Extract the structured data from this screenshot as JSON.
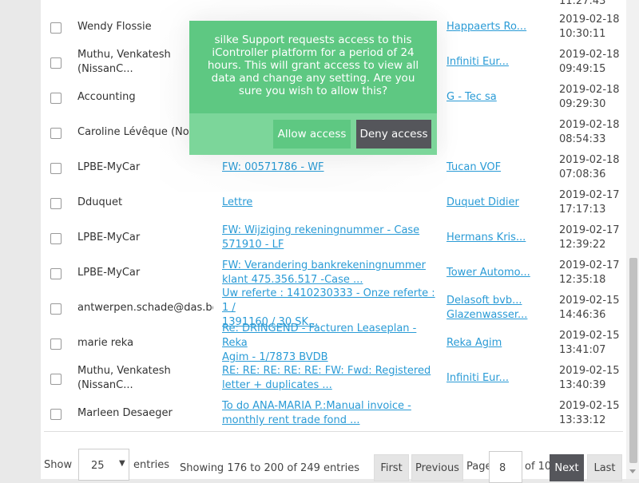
{
  "table": {
    "top_partial_time": "11:27:43",
    "rows": [
      {
        "name": "Wendy Flossie",
        "subject": "",
        "contact": "Happaerts Ro...",
        "date": "2019-02-18\n10:30:11"
      },
      {
        "name": "Muthu, Venkatesh\n(NissanC...",
        "subject": "",
        "contact": "Infiniti Eur...",
        "date": "2019-02-18\n09:49:15"
      },
      {
        "name": "Accounting",
        "subject": "",
        "contact": "G - Tec sa",
        "date": "2019-02-18\n09:29:30"
      },
      {
        "name": "Caroline Lévêque (Nota",
        "subject": "",
        "contact": "",
        "date": "2019-02-18\n08:54:33"
      },
      {
        "name": "LPBE-MyCar",
        "subject": "FW: 00571786 - WF",
        "contact": "Tucan VOF",
        "date": "2019-02-18\n07:08:36"
      },
      {
        "name": "Dduquet",
        "subject": "Lettre",
        "contact": "Duquet Didier",
        "date": "2019-02-17\n17:17:13"
      },
      {
        "name": "LPBE-MyCar",
        "subject": "FW: Wijziging rekeningnummer - Case\n571910 - LF",
        "contact": "Hermans Kris...",
        "date": "2019-02-17\n12:39:22"
      },
      {
        "name": "LPBE-MyCar",
        "subject": "FW: Verandering bankrekeningnummer\nklant 475.356.517 -Case ...",
        "contact": "Tower Automo...",
        "date": "2019-02-17\n12:35:18"
      },
      {
        "name": "antwerpen.schade@das.be",
        "subject": "Uw referte : 1410230333 - Onze referte : 1 /\n1391160 / 30 SK...",
        "contact": "Delasoft bvb...\nGlazenwasser...",
        "date": "2019-02-15\n14:46:36"
      },
      {
        "name": "marie reka",
        "subject": "Re: DRINGEND - Facturen Leaseplan - Reka\nAgim - 1/7873 BVDB",
        "contact": "Reka Agim",
        "date": "2019-02-15\n13:41:07"
      },
      {
        "name": "Muthu, Venkatesh\n(NissanC...",
        "subject": "RE: RE: RE: RE: RE: FW: Fwd: Registered\nletter + duplicates ...",
        "contact": "Infiniti Eur...",
        "date": "2019-02-15\n13:40:39"
      },
      {
        "name": "Marleen Desaeger",
        "subject": "To do ANA-MARIA P.:Manual invoice -\nmonthly rent trade fond ...",
        "contact": "",
        "date": "2019-02-15\n13:33:12"
      }
    ]
  },
  "footer": {
    "show_label": "Show",
    "entries_value": "25",
    "entries_label": "entries",
    "info": "Showing 176 to 200 of 249 entries",
    "first": "First",
    "previous": "Previous",
    "page_label": "Page",
    "page_value": "8",
    "of_label": "of 10",
    "next": "Next",
    "last": "Last"
  },
  "modal": {
    "message": "silke Support requests access to this iController platform for a period of 24 hours. This will grant access to view all data and change any setting. Are you sure you wish to allow this?",
    "allow_label": "Allow access",
    "deny_label": "Deny access"
  },
  "colors": {
    "modal_green": "#5ec882",
    "button_dark": "#55565b",
    "link_blue": "#2a9bd6"
  }
}
